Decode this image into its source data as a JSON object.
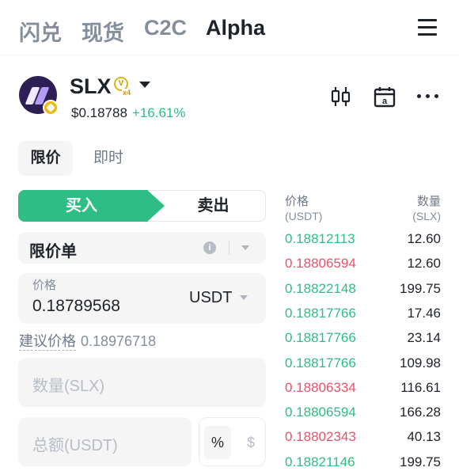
{
  "nav": {
    "tabs": [
      "闪兑",
      "现货",
      "C2C",
      "Alpha"
    ],
    "active": "Alpha"
  },
  "token": {
    "symbol": "SLX",
    "boost_mark": "V",
    "boost_multiplier": "x4",
    "price": "$0.18788",
    "change": "+16.61%",
    "change_color": "#2ebd85"
  },
  "order_tabs": {
    "limit": "限价",
    "instant": "即时"
  },
  "side": {
    "buy": "买入",
    "sell": "卖出",
    "buy_color": "#2ebd85",
    "sell_color": "#e8536a"
  },
  "order_type": {
    "label": "限价单",
    "info_icon": "info-icon"
  },
  "price_input": {
    "label": "价格",
    "value": "0.18789568",
    "unit": "USDT"
  },
  "suggested": {
    "label": "建议价格",
    "value": "0.18976718"
  },
  "quantity": {
    "placeholder": "数量(SLX)"
  },
  "total": {
    "placeholder": "总额(USDT)",
    "pct_label": "%",
    "usd_label": "$"
  },
  "orderbook": {
    "price_header": "价格",
    "price_unit": "(USDT)",
    "qty_header": "数量",
    "qty_unit": "(SLX)",
    "rows": [
      {
        "price": "0.18812113",
        "qty": "12.60",
        "side": "buy"
      },
      {
        "price": "0.18806594",
        "qty": "12.60",
        "side": "sell"
      },
      {
        "price": "0.18822148",
        "qty": "199.75",
        "side": "buy"
      },
      {
        "price": "0.18817766",
        "qty": "17.46",
        "side": "buy"
      },
      {
        "price": "0.18817766",
        "qty": "23.14",
        "side": "buy"
      },
      {
        "price": "0.18817766",
        "qty": "109.98",
        "side": "buy"
      },
      {
        "price": "0.18806334",
        "qty": "116.61",
        "side": "sell"
      },
      {
        "price": "0.18806594",
        "qty": "166.28",
        "side": "buy"
      },
      {
        "price": "0.18802343",
        "qty": "40.13",
        "side": "sell"
      },
      {
        "price": "0.18821146",
        "qty": "199.75",
        "side": "buy"
      }
    ]
  }
}
